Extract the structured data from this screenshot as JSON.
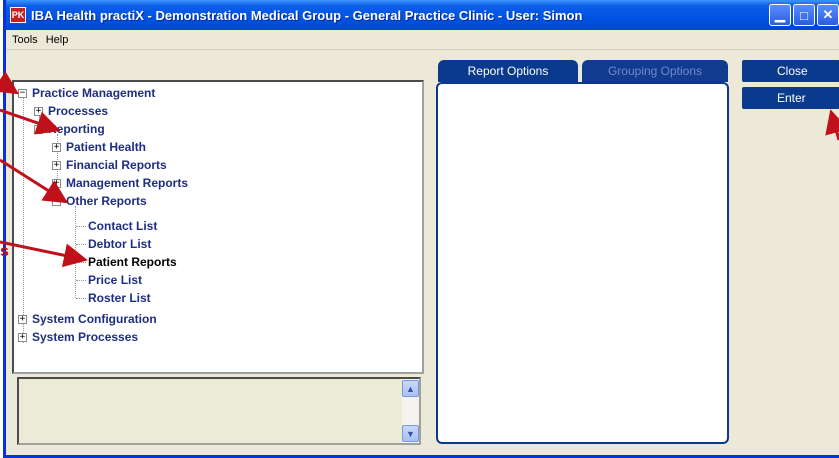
{
  "window": {
    "app_icon": "PK",
    "title": "IBA Health practiX - Demonstration Medical Group - General Practice Clinic - User: Simon",
    "controls": [
      "minimize-icon",
      "maximize-icon",
      "close-icon"
    ]
  },
  "menu": {
    "items": [
      {
        "label": "Tools"
      },
      {
        "label": "Help"
      }
    ]
  },
  "tree": {
    "practice_management": "Practice Management",
    "processes": "Processes",
    "reporting": "Reporting",
    "patient_health": "Patient Health",
    "financial_reports": "Financial Reports",
    "management_reports": "Management Reports",
    "other_reports": "Other Reports",
    "contact_list": "Contact List",
    "debtor_list": "Debtor List",
    "patient_reports": "Patient Reports",
    "price_list": "Price List",
    "roster_list": "Roster List",
    "system_configuration": "System Configuration",
    "system_processes": "System Processes",
    "expanded_glyph": "−",
    "collapsed_glyph": "+"
  },
  "tabs": {
    "report_options": "Report Options",
    "grouping_options": "Grouping Options"
  },
  "buttons": {
    "close": "Close",
    "enter": "Enter"
  },
  "annotation": {
    "fragment": "s"
  },
  "colors": {
    "arrow": "#c0101a",
    "accent": "#0a3a8e",
    "title_bar": "#0054e3"
  }
}
